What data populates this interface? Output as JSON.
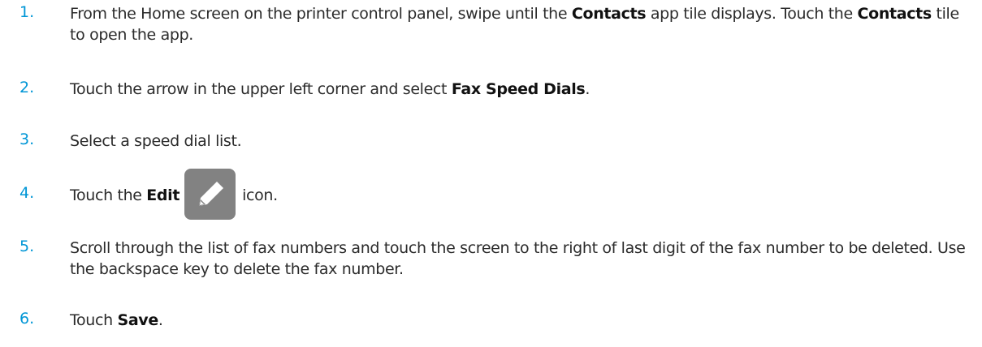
{
  "steps": [
    {
      "number": "1.",
      "parts": [
        {
          "text": "From the Home screen on the printer control panel, swipe until the "
        },
        {
          "text": "Contacts",
          "bold": true
        },
        {
          "text": " app tile displays. Touch the "
        },
        {
          "text": "Contacts",
          "bold": true
        },
        {
          "text": " tile to open the app."
        }
      ]
    },
    {
      "number": "2.",
      "parts": [
        {
          "text": "Touch the arrow in the upper left corner and select "
        },
        {
          "text": "Fax Speed Dials",
          "bold": true
        },
        {
          "text": "."
        }
      ]
    },
    {
      "number": "3.",
      "parts": [
        {
          "text": "Select a speed dial list."
        }
      ]
    },
    {
      "number": "4.",
      "parts": [
        {
          "text": "Touch the "
        },
        {
          "text": "Edit",
          "bold": true
        },
        {
          "icon": "pencil-edit-icon"
        },
        {
          "text": "icon."
        }
      ]
    },
    {
      "number": "5.",
      "parts": [
        {
          "text": "Scroll through the list of fax numbers and touch the screen to the right of last digit of the fax number to be deleted. Use the backspace key to delete the fax number."
        }
      ]
    },
    {
      "number": "6.",
      "parts": [
        {
          "text": "Touch "
        },
        {
          "text": "Save",
          "bold": true
        },
        {
          "text": "."
        }
      ]
    }
  ],
  "colors": {
    "step_number": "#0096d6",
    "body_text": "#2b2b2b",
    "icon_background": "#828282"
  }
}
